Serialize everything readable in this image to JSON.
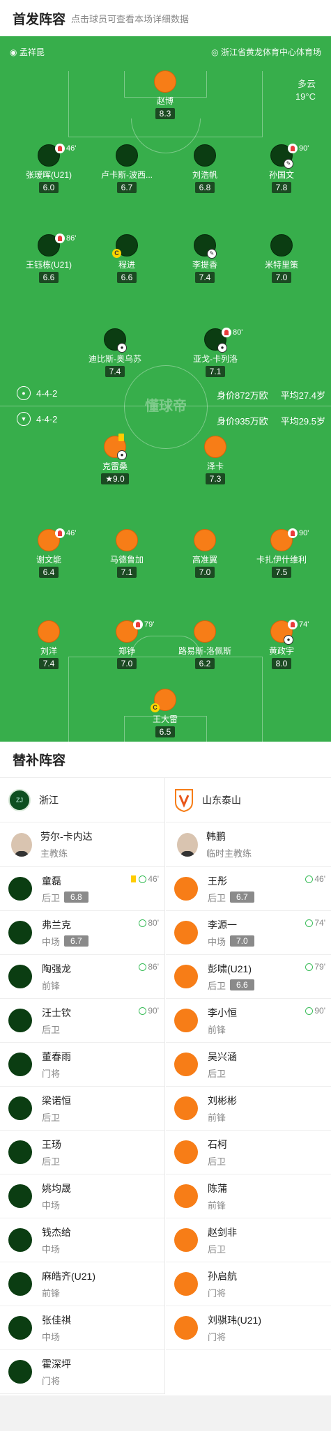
{
  "header": {
    "title": "首发阵容",
    "subtitle": "点击球员可查看本场详细数据"
  },
  "match": {
    "referee": "孟祥昆",
    "venue": "浙江省黄龙体育中心体育场",
    "weather": "多云",
    "temperature": "19°C",
    "watermark": "懂球帝"
  },
  "home": {
    "formation": "4-4-2",
    "value": "身价872万欧",
    "age": "平均27.4岁",
    "players": [
      {
        "name": "赵博",
        "rating": "8.3"
      },
      {
        "name": "张瑷晖(U21)",
        "rating": "6.0",
        "sub": "46'"
      },
      {
        "name": "卢卡斯-波西...",
        "rating": "6.7"
      },
      {
        "name": "刘浩帆",
        "rating": "6.8"
      },
      {
        "name": "孙国文",
        "rating": "7.8",
        "sub": "90'"
      },
      {
        "name": "王钰栋(U21)",
        "rating": "6.6",
        "sub": "86'"
      },
      {
        "name": "程进",
        "rating": "6.6"
      },
      {
        "name": "李提香",
        "rating": "7.4"
      },
      {
        "name": "米特里策",
        "rating": "7.0"
      },
      {
        "name": "迪比斯-奥乌苏",
        "rating": "7.4"
      },
      {
        "name": "亚戈-卡列洛",
        "rating": "7.1",
        "sub": "80'"
      }
    ]
  },
  "away": {
    "formation": "4-4-2",
    "value": "身价935万欧",
    "age": "平均29.5岁",
    "players": [
      {
        "name": "克雷桑",
        "rating": "9.0"
      },
      {
        "name": "泽卡",
        "rating": "7.3"
      },
      {
        "name": "谢文能",
        "rating": "6.4",
        "sub": "46'"
      },
      {
        "name": "马德鲁加",
        "rating": "7.1"
      },
      {
        "name": "高准翼",
        "rating": "7.0"
      },
      {
        "name": "卡扎伊什维利",
        "rating": "7.5",
        "sub": "90'"
      },
      {
        "name": "刘洋",
        "rating": "7.4"
      },
      {
        "name": "郑铮",
        "rating": "7.0",
        "sub": "79'"
      },
      {
        "name": "路易斯-洛佩斯",
        "rating": "6.2"
      },
      {
        "name": "黄政宇",
        "rating": "8.0",
        "sub": "74'"
      },
      {
        "name": "王大雷",
        "rating": "6.5"
      }
    ]
  },
  "subs": {
    "title": "替补阵容",
    "home": {
      "team": "浙江",
      "coach": {
        "name": "劳尔-卡内达",
        "role": "主教练"
      },
      "players": [
        {
          "name": "童磊",
          "pos": "后卫",
          "rating": "6.8",
          "minute": "46'"
        },
        {
          "name": "弗兰克",
          "pos": "中场",
          "rating": "6.7",
          "minute": "80'"
        },
        {
          "name": "陶强龙",
          "pos": "前锋",
          "minute": "86'"
        },
        {
          "name": "汪士钦",
          "pos": "后卫",
          "minute": "90'"
        },
        {
          "name": "董春雨",
          "pos": "门将"
        },
        {
          "name": "梁诺恒",
          "pos": "后卫"
        },
        {
          "name": "王玚",
          "pos": "后卫"
        },
        {
          "name": "姚均晟",
          "pos": "中场"
        },
        {
          "name": "钱杰给",
          "pos": "中场"
        },
        {
          "name": "麻皓齐(U21)",
          "pos": "前锋"
        },
        {
          "name": "张佳祺",
          "pos": "中场"
        },
        {
          "name": "霍深坪",
          "pos": "门将"
        }
      ]
    },
    "away": {
      "team": "山东泰山",
      "coach": {
        "name": "韩鹏",
        "role": "临时主教练"
      },
      "players": [
        {
          "name": "王彤",
          "pos": "后卫",
          "rating": "6.7",
          "minute": "46'"
        },
        {
          "name": "李源一",
          "pos": "中场",
          "rating": "7.0",
          "minute": "74'"
        },
        {
          "name": "彭啸(U21)",
          "pos": "后卫",
          "rating": "6.6",
          "minute": "79'"
        },
        {
          "name": "李小恒",
          "pos": "前锋",
          "minute": "90'"
        },
        {
          "name": "吴兴涵",
          "pos": "后卫"
        },
        {
          "name": "刘彬彬",
          "pos": "前锋"
        },
        {
          "name": "石柯",
          "pos": "后卫"
        },
        {
          "name": "陈蒲",
          "pos": "前锋"
        },
        {
          "name": "赵剑非",
          "pos": "后卫"
        },
        {
          "name": "孙启航",
          "pos": "门将"
        },
        {
          "name": "刘骐玮(U21)",
          "pos": "门将"
        }
      ]
    }
  }
}
